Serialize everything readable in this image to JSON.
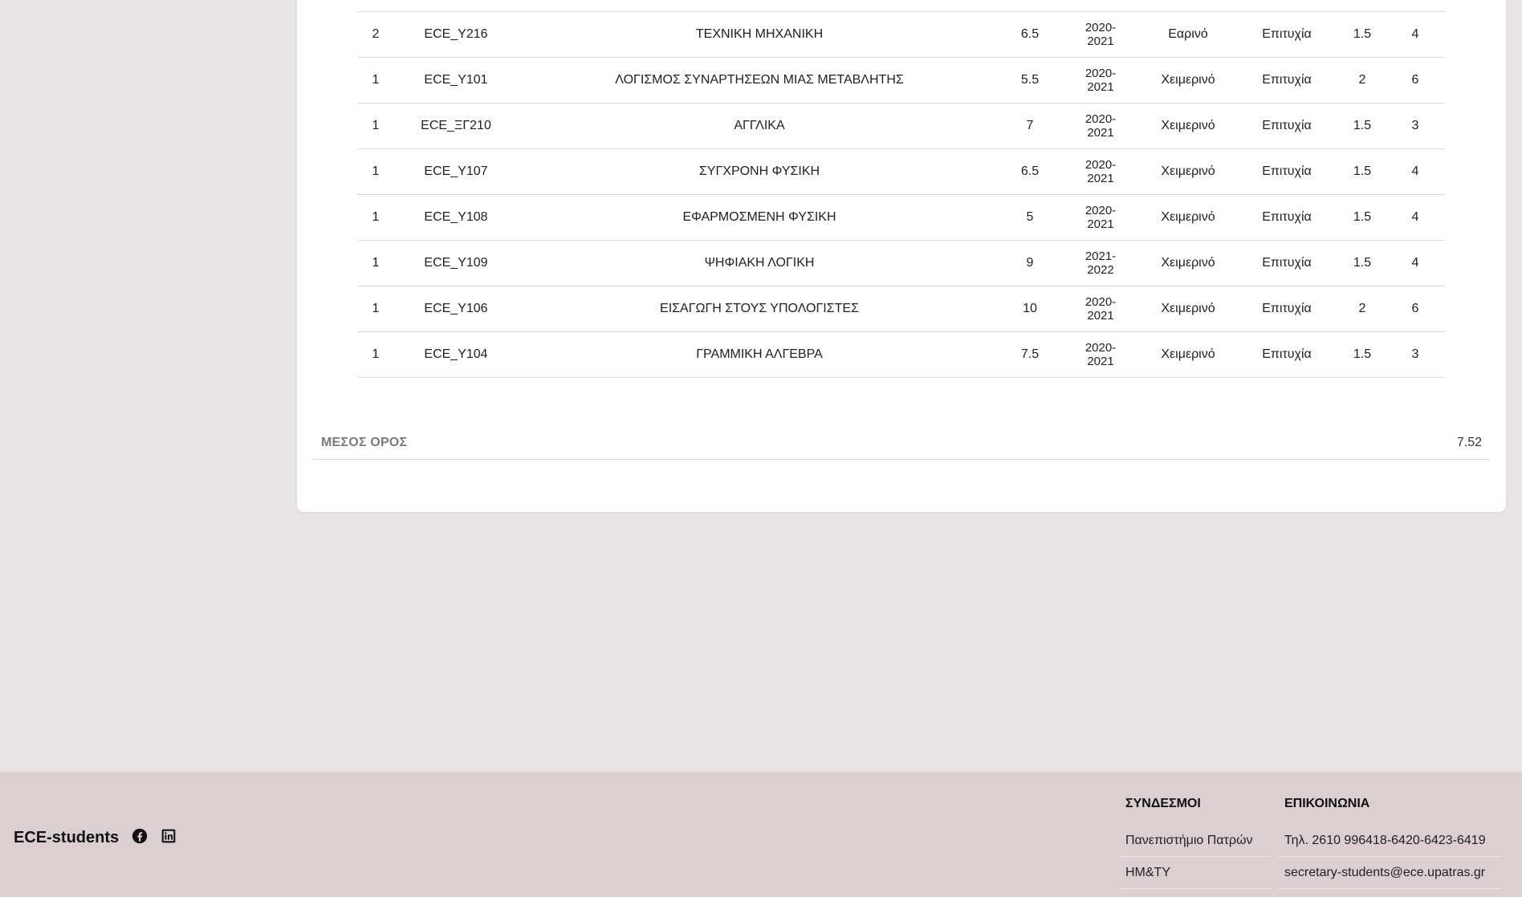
{
  "grades": [
    {
      "semester": "2",
      "code": "ECE_Y216",
      "title": "ΤΕΧΝΙΚΗ ΜΗΧΑΝΙΚΗ",
      "grade": "6.5",
      "year": [
        "2020-",
        "2021"
      ],
      "period": "Εαρινό",
      "result": "Επιτυχία",
      "weight": "1.5",
      "ects": "4"
    },
    {
      "semester": "1",
      "code": "ECE_Y101",
      "title": "ΛΟΓΙΣΜΟΣ ΣΥΝΑΡΤΗΣΕΩΝ ΜΙΑΣ ΜΕΤΑΒΛΗΤΗΣ",
      "grade": "5.5",
      "year": [
        "2020-",
        "2021"
      ],
      "period": "Χειμερινό",
      "result": "Επιτυχία",
      "weight": "2",
      "ects": "6"
    },
    {
      "semester": "1",
      "code": "ECE_ΞΓ210",
      "title": "ΑΓΓΛΙΚΑ",
      "grade": "7",
      "year": [
        "2020-",
        "2021"
      ],
      "period": "Χειμερινό",
      "result": "Επιτυχία",
      "weight": "1.5",
      "ects": "3"
    },
    {
      "semester": "1",
      "code": "ECE_Y107",
      "title": "ΣΥΓΧΡΟΝΗ ΦΥΣΙΚΗ",
      "grade": "6.5",
      "year": [
        "2020-",
        "2021"
      ],
      "period": "Χειμερινό",
      "result": "Επιτυχία",
      "weight": "1.5",
      "ects": "4"
    },
    {
      "semester": "1",
      "code": "ECE_Y108",
      "title": "ΕΦΑΡΜΟΣΜΕΝΗ ΦΥΣΙΚΗ",
      "grade": "5",
      "year": [
        "2020-",
        "2021"
      ],
      "period": "Χειμερινό",
      "result": "Επιτυχία",
      "weight": "1.5",
      "ects": "4"
    },
    {
      "semester": "1",
      "code": "ECE_Y109",
      "title": "ΨΗΦΙΑΚΗ ΛΟΓΙΚΗ",
      "grade": "9",
      "year": [
        "2021-",
        "2022"
      ],
      "period": "Χειμερινό",
      "result": "Επιτυχία",
      "weight": "1.5",
      "ects": "4"
    },
    {
      "semester": "1",
      "code": "ECE_Y106",
      "title": "ΕΙΣΑΓΩΓΗ ΣΤΟΥΣ ΥΠΟΛΟΓΙΣΤΕΣ",
      "grade": "10",
      "year": [
        "2020-",
        "2021"
      ],
      "period": "Χειμερινό",
      "result": "Επιτυχία",
      "weight": "2",
      "ects": "6"
    },
    {
      "semester": "1",
      "code": "ECE_Y104",
      "title": "ΓΡΑΜΜΙΚΗ ΑΛΓΕΒΡΑ",
      "grade": "7.5",
      "year": [
        "2020-",
        "2021"
      ],
      "period": "Χειμερινό",
      "result": "Επιτυχία",
      "weight": "1.5",
      "ects": "3"
    }
  ],
  "average": {
    "label": "ΜΕΣΟΣ ΟΡΟΣ",
    "value": "7.52"
  },
  "footer": {
    "brand": "ECE-students",
    "social_icons": [
      "facebook-icon",
      "linkedin-icon"
    ],
    "links": {
      "heading": "ΣΥΝΔΕΣΜΟΙ",
      "items": [
        "Πανεπιστήμιο Πατρών",
        "ΗΜ&ΤΥ"
      ]
    },
    "contact": {
      "heading": "ΕΠΙΚΟΙΝΩΝΙΑ",
      "items": [
        "Τηλ. 2610 996418-6420-6423-6419",
        "secretary-students@ece.upatras.gr"
      ]
    }
  },
  "colors": {
    "background": "#e9e3e3",
    "card": "#ffffff",
    "footer": "#dbcfd0",
    "muted_label": "#7a7a7a"
  }
}
